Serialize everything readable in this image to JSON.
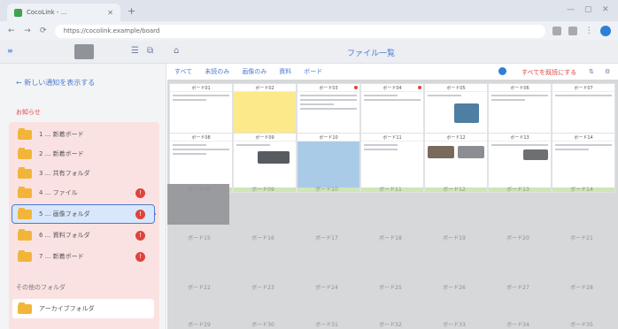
{
  "browser": {
    "tab_title": "CocoLink - ...",
    "new_tab": "+",
    "url": "https://cocolink.example/board",
    "win_min": "—",
    "win_max": "▢",
    "win_close": "✕"
  },
  "app": {
    "left_label": "≡",
    "title": "ファイル一覧"
  },
  "sidebar": {
    "back_link": "← 新しい通知を表示する",
    "section_label": "お知らせ",
    "items": [
      {
        "label": "1 ... 新着ボード"
      },
      {
        "label": "2 ... 新着ボード"
      },
      {
        "label": "3 ... 共有フォルダ"
      },
      {
        "label": "4 ... ファイル"
      },
      {
        "label": "5 ... 画像フォルダ"
      },
      {
        "label": "6 ... 資料フォルダ"
      },
      {
        "label": "7 ... 新着ボード"
      }
    ],
    "alert_symbol": "!",
    "chevron": "›",
    "section2_label": "その他のフォルダ",
    "bottom_item": "アーカイブフォルダ"
  },
  "filters": [
    "すべて",
    "未読のみ",
    "画像のみ",
    "資料",
    "ボード"
  ],
  "red_link": "すべてを既読にする",
  "cards_row1": [
    "ボード01",
    "ボード02",
    "ボード03",
    "ボード04",
    "ボード05",
    "ボード06",
    "ボード07"
  ],
  "cards_row2": [
    "ボード08",
    "ボード09",
    "ボード10",
    "ボード11",
    "ボード12",
    "ボード13",
    "ボード14"
  ],
  "row3_labels": [
    "ボード15",
    "ボード16",
    "ボード17",
    "ボード18",
    "ボード19",
    "ボード20",
    "ボード21"
  ],
  "row4_labels": [
    "ボード22",
    "ボード23",
    "ボード24",
    "ボード25",
    "ボード26",
    "ボード27",
    "ボード28"
  ],
  "row5_labels": [
    "ボード29",
    "ボード30",
    "ボード31",
    "ボード32",
    "ボード33",
    "ボード34",
    "ボード35"
  ],
  "colors": {
    "accent": "#4d7bd1",
    "alert": "#e0433c",
    "folder": "#f2b53a",
    "sidebar_highlight": "#fbe2e2"
  }
}
